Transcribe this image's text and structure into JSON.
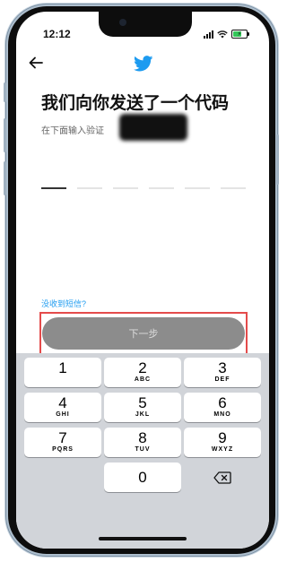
{
  "status": {
    "time": "12:12"
  },
  "screen": {
    "title": "我们向你发送了一个代码",
    "subtitle": "在下面输入验证",
    "resend_link": "没收到短信?",
    "next_button": "下一步",
    "code_digits": [
      "",
      "",
      "",
      "",
      "",
      ""
    ]
  },
  "keyboard": {
    "keys": [
      {
        "num": "1",
        "letters": ""
      },
      {
        "num": "2",
        "letters": "ABC"
      },
      {
        "num": "3",
        "letters": "DEF"
      },
      {
        "num": "4",
        "letters": "GHI"
      },
      {
        "num": "5",
        "letters": "JKL"
      },
      {
        "num": "6",
        "letters": "MNO"
      },
      {
        "num": "7",
        "letters": "PQRS"
      },
      {
        "num": "8",
        "letters": "TUV"
      },
      {
        "num": "9",
        "letters": "WXYZ"
      },
      {
        "num": "0",
        "letters": ""
      }
    ],
    "delete_icon": "delete-backspace-icon"
  },
  "colors": {
    "brand": "#1d9bf0",
    "button_disabled": "#8c8c8c",
    "highlight_frame": "#e44b4b",
    "battery": "#34c759"
  }
}
